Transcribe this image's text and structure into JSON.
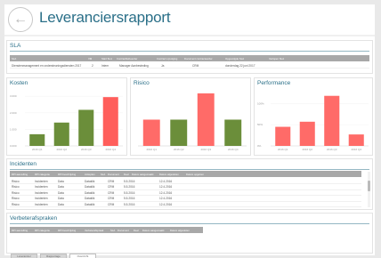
{
  "header": {
    "title": "Leveranciersrapport",
    "back_icon": "arrow-left-icon"
  },
  "sla": {
    "title": "SLA",
    "columns": [
      "SLA",
      "VM",
      "Start SLA",
      "Contractbeheerder",
      "Contract opvolging",
      "Document contracteerder",
      "Opgevolgde SLA",
      "Verlopen SLA"
    ],
    "row": [
      "Dienstenmanagement en ondersteuningsdiensten 2017",
      "2",
      "Intern",
      "Manager Aanbesteding",
      "Ja",
      "CRM",
      "donderdag 22 juni 2017",
      ""
    ]
  },
  "kosten": {
    "title": "Kosten",
    "chart_data": {
      "type": "bar",
      "categories": [
        "2016 Q1",
        "2016 Q2",
        "2016 Q3",
        "2016 Q4"
      ],
      "values": [
        1100,
        2200,
        3400,
        4600
      ],
      "yticks": [
        "0.000",
        "1.000",
        "2.000",
        "3.000"
      ],
      "ylim": [
        0,
        5200
      ],
      "color": "#6b8e3a",
      "highlight_color": "#ff5e5b"
    }
  },
  "risico": {
    "title": "Risico",
    "chart_data": {
      "type": "bar",
      "categories": [
        "2016 Q1",
        "2016 Q2",
        "2016 Q3",
        "2016 Q4"
      ],
      "values": [
        2,
        2,
        4,
        2
      ],
      "colors": [
        "#ff6b68",
        "#6b8e3a",
        "#ff6b68",
        "#6b8e3a"
      ],
      "ylim": [
        0,
        4.2
      ]
    }
  },
  "performance": {
    "title": "Performance",
    "chart_data": {
      "type": "bar",
      "categories": [
        "2016 Q1",
        "2016 Q2",
        "2016 Q3",
        "2016 Q4"
      ],
      "values": [
        45,
        57,
        118,
        27
      ],
      "colors": [
        "#ff6b68",
        "#ff6b68",
        "#ff6b68",
        "#ff6b68"
      ],
      "yticks": [
        "0%",
        "50%",
        "100%"
      ],
      "ylim": [
        0,
        130
      ]
    }
  },
  "incidenten": {
    "title": "Incidenten",
    "columns": [
      "RPI aanvulling",
      "RPI categorie",
      "RPI beschrijving",
      "Actieplan",
      "SLA",
      "Document",
      "Deel",
      "Datum aangemaakt",
      "Datum afgesloten",
      "Datum opgelost"
    ],
    "rows": [
      [
        "Risico",
        "Incidenten",
        "Data",
        "Dataklik",
        "",
        "CRM",
        "5.5.2016",
        "",
        "12.4.2016"
      ],
      [
        "Risico",
        "Incidenten",
        "Data",
        "Dataklik",
        "",
        "CRM",
        "5.5.2016",
        "",
        "12.4.2016"
      ],
      [
        "Risico",
        "Incidenten",
        "Data",
        "Dataklik",
        "",
        "CRM",
        "5.5.2016",
        "",
        "12.4.2016"
      ],
      [
        "Risico",
        "Incidenten",
        "Data",
        "Dataklik",
        "",
        "CRM",
        "5.5.2016",
        "",
        "12.4.2016"
      ],
      [
        "Risico",
        "Incidenten",
        "Data",
        "Dataklik",
        "",
        "CRM",
        "5.5.2016",
        "",
        "12.4.2016"
      ]
    ]
  },
  "verbeterafspraken": {
    "title": "Verbeterafspraken",
    "columns": [
      "RPI aanvulling",
      "RPI categorie",
      "RPI beschrijving",
      "Verbeterafspraak",
      "SLA",
      "Document",
      "Deel",
      "Datum aangemaakt",
      "Datum afgesloten"
    ]
  },
  "tabs": [
    "Leverancier",
    "Rapportage",
    "Overzicht"
  ]
}
